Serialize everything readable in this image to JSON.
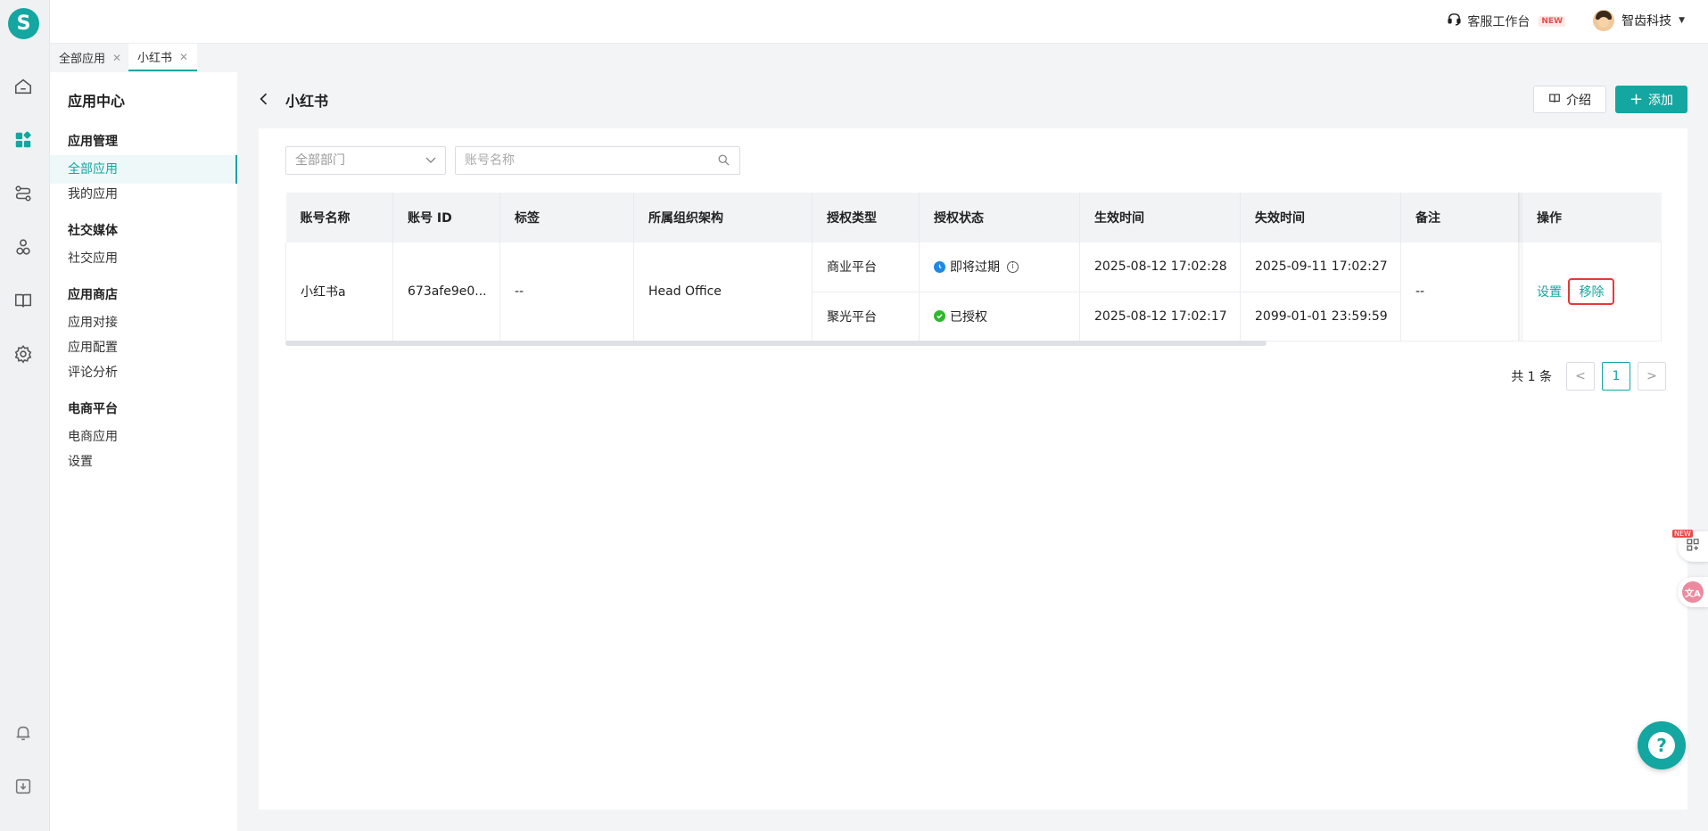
{
  "brand": {
    "logo_letter": "S",
    "accent": "#14a6a0"
  },
  "rail": {
    "icons": [
      "home-icon",
      "apps-icon",
      "workflow-icon",
      "crm-icon",
      "book-icon",
      "settings-icon",
      "bell-icon",
      "download-icon"
    ]
  },
  "header": {
    "cs_desk_label": "客服工作台",
    "cs_desk_badge": "NEW",
    "user_name": "智齿科技"
  },
  "tabs": [
    {
      "label": "全部应用"
    },
    {
      "label": "小红书"
    }
  ],
  "sidebar": {
    "title": "应用中心",
    "groups": [
      {
        "title": "应用管理",
        "items": [
          "全部应用",
          "我的应用"
        ]
      },
      {
        "title": "社交媒体",
        "items": [
          "社交应用"
        ]
      },
      {
        "title": "应用商店",
        "items": [
          "应用对接",
          "应用配置",
          "评论分析"
        ]
      },
      {
        "title": "电商平台",
        "items": [
          "电商应用",
          "设置"
        ]
      }
    ],
    "active_item": "全部应用"
  },
  "page": {
    "title": "小红书",
    "intro_label": "介绍",
    "add_label": "添加"
  },
  "filters": {
    "dept_placeholder": "全部部门",
    "search_placeholder": "账号名称"
  },
  "table": {
    "columns": [
      "账号名称",
      "账号 ID",
      "标签",
      "所属组织架构",
      "授权类型",
      "授权状态",
      "生效时间",
      "失效时间",
      "备注",
      "操作"
    ],
    "row": {
      "name": "小红书a",
      "id": "673afe9e0...",
      "tag": "--",
      "org": "Head Office",
      "note": "--",
      "sub": [
        {
          "auth_type": "商业平台",
          "status": "即将过期",
          "status_color": "#1e88e5",
          "start": "2025-08-12 17:02:28",
          "end": "2025-09-11 17:02:27"
        },
        {
          "auth_type": "聚光平台",
          "status": "已授权",
          "status_color": "#2eb82e",
          "start": "2025-08-12 17:02:17",
          "end": "2099-01-01 23:59:59"
        }
      ],
      "action_settings": "设置",
      "action_remove": "移除"
    }
  },
  "pagination": {
    "total_text": "共 1 条",
    "current_page": "1",
    "prev": "<",
    "next": ">"
  },
  "floating": {
    "apps_badge": "NEW",
    "translate_label": "文A",
    "help_label": "?"
  }
}
